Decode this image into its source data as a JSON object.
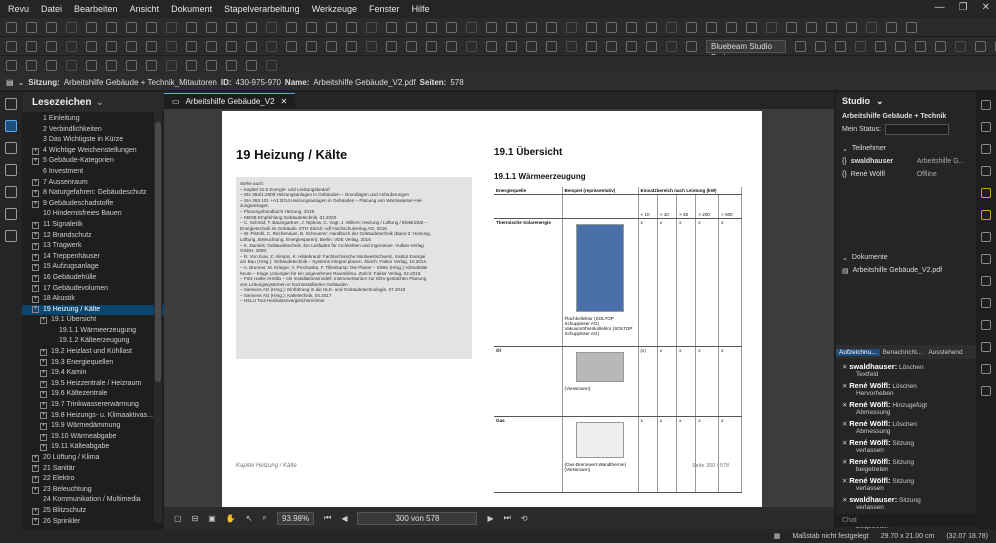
{
  "menu": [
    "Revu",
    "Datei",
    "Bearbeiten",
    "Ansicht",
    "Dokument",
    "Stapelverarbeitung",
    "Werkzeuge",
    "Fenster",
    "Hilfe"
  ],
  "toolbar": {
    "profile": "Bluebeam Studio Proje"
  },
  "infobar": {
    "session_label": "Sitzung:",
    "session_value": "Arbeitshilfe Gebäude + Technik_Mitautoren",
    "id_label": "ID:",
    "id_value": "430-975-970",
    "name_label": "Name:",
    "name_value": "Arbeitshilfe Gebäude_V2.pdf",
    "pages_label": "Seiten:",
    "pages_value": "578"
  },
  "sidebar": {
    "title": "Lesezeichen",
    "items": [
      {
        "label": "1 Einleitung",
        "indent": 0,
        "exp": false
      },
      {
        "label": "2 Verbindlichkeiten",
        "indent": 0,
        "exp": false
      },
      {
        "label": "3 Das Wichtigste in Kürze",
        "indent": 0,
        "exp": false
      },
      {
        "label": "4 Wichtige Weichenstellungen",
        "indent": 0,
        "exp": true
      },
      {
        "label": "5 Gebäude-Kategorien",
        "indent": 0,
        "exp": true
      },
      {
        "label": "6 Investment",
        "indent": 0,
        "exp": false
      },
      {
        "label": "7 Aussenraum",
        "indent": 0,
        "exp": true
      },
      {
        "label": "8 Naturgefahren: Gebäudeschutz",
        "indent": 0,
        "exp": true
      },
      {
        "label": "9 Gebäudeschadstoffe",
        "indent": 0,
        "exp": true
      },
      {
        "label": "10 Hindernisfreies Bauen",
        "indent": 0,
        "exp": false
      },
      {
        "label": "11 Signaletik",
        "indent": 0,
        "exp": true
      },
      {
        "label": "12 Brandschutz",
        "indent": 0,
        "exp": true
      },
      {
        "label": "13 Tragwerk",
        "indent": 0,
        "exp": true
      },
      {
        "label": "14 Treppenhäuser",
        "indent": 0,
        "exp": true
      },
      {
        "label": "15 Aufzugsanlage",
        "indent": 0,
        "exp": true
      },
      {
        "label": "16 Gebäudehülle",
        "indent": 0,
        "exp": true
      },
      {
        "label": "17 Gebäudevolumen",
        "indent": 0,
        "exp": true
      },
      {
        "label": "18 Akustik",
        "indent": 0,
        "exp": true
      },
      {
        "label": "19 Heizung / Kälte",
        "indent": 0,
        "exp": true,
        "selected": true
      },
      {
        "label": "19.1 Übersicht",
        "indent": 1,
        "exp": true
      },
      {
        "label": "19.1.1 Wärmeerzeugung",
        "indent": 2,
        "exp": false
      },
      {
        "label": "19.1.2 Kälteerzeugung",
        "indent": 2,
        "exp": false
      },
      {
        "label": "19.2 Heizlast und Kühllast",
        "indent": 1,
        "exp": true
      },
      {
        "label": "19.3 Energiequellen",
        "indent": 1,
        "exp": true
      },
      {
        "label": "19.4 Kamin",
        "indent": 1,
        "exp": true
      },
      {
        "label": "19.5 Heizzentrale / Heizraum",
        "indent": 1,
        "exp": true
      },
      {
        "label": "19.6 Kältezentrale",
        "indent": 1,
        "exp": true
      },
      {
        "label": "19.7 Trinkwassererwärmung",
        "indent": 1,
        "exp": true
      },
      {
        "label": "19.8 Heizungs- u. Klimaaktivas...",
        "indent": 1,
        "exp": true
      },
      {
        "label": "19.9 Wärmedämmung",
        "indent": 1,
        "exp": true
      },
      {
        "label": "19.10 Wärmeabgabe",
        "indent": 1,
        "exp": true
      },
      {
        "label": "19.11 Kälteabgabe",
        "indent": 1,
        "exp": true
      },
      {
        "label": "20 Lüftung / Klima",
        "indent": 0,
        "exp": true
      },
      {
        "label": "21 Sanitär",
        "indent": 0,
        "exp": true
      },
      {
        "label": "22 Elektro",
        "indent": 0,
        "exp": true
      },
      {
        "label": "23 Beleuchtung",
        "indent": 0,
        "exp": true
      },
      {
        "label": "24 Kommunikation / Multimedia",
        "indent": 0,
        "exp": false
      },
      {
        "label": "25 Blitzschutz",
        "indent": 0,
        "exp": true
      },
      {
        "label": "26 Sprinkler",
        "indent": 0,
        "exp": true
      }
    ]
  },
  "doc_tab": "Arbeitshilfe Gebäude_V2",
  "page": {
    "heading": "19   Heizung / Kälte",
    "refs": [
      "Siehe auch:",
      "– Kapitel 31.9 Energie- und Leistungsbedarf",
      "– SIA 384/1:2009 Heizungsanlagen in Gebäuden – Grundlagen und Anforderungen",
      "– SIA 384.101 +A1:2014 Heizungsanlagen in Gebäuden – Planung von Warmwasser-Hei-",
      "  zungsanlagen",
      "– Planungshandbuch Heizung, 2019",
      "– KBOB Empfehlung Gebäudetechnik, 01.2020",
      "– C. Schmid, T. Baumgartner, J. Nipkow, C. Vogt, J. Willers: Heizung / Lüftung / Elektrizität –",
      "  Energietechnik im Gebäude. ETH Zürich: vdf Hochschulverlag AG, 2016.",
      "– W. Pistohl, C. Rechenauer, B. Scheuerer: Handbuch der Gebäudetechnik (Band 2: Heizung,",
      "  Lüftung, Beleuchtung, Energiesparen). Berlin: VDE Verlag, 2016.",
      "– K. Daniels: Gebäudetechnik. Ein Leitfaden für Architekten und Ingenieure. Vulkan-Verlag",
      "  GmbH, 2000.",
      "– R. Von Euw, Z. Alimpic, K. Hildebrand: Fachtechnische Nordwestschweiz, Institut Energie",
      "  am Bau (Hrsg.): Gebäudetechnik – Systeme integral planen. Zürich: Faktor Verlag, 10.2012.",
      "– A. Brunner, M. Krieger, V. Prochaska, F. Tillenkamp: Die Planer – SWKI (Hrsg.): Klimakälte",
      "  heute – Kluge Lösungen für ein angenehmes Raumklima. Zürich: Faktor Verlag, 02.2019.",
      "– Fritz Haller Armilla – ein Installationsmodell: Instrumentarium zur EDV-gestützten Planung",
      "  von Leitungssystemen in hochinstallierten Gebäuden",
      "– Siemens AG (Hrsg.): Einführung in die HLK- und Gebäudetechnologie, 07.2019",
      "– Siemens AG (Hrsg.): Kältetechnik, 04.2017",
      "– HSLU Tool Heizlastenvergleichsrechner"
    ],
    "section": "19.1   Übersicht",
    "subsection": "19.1.1   Wärmeerzeugung",
    "table": {
      "h_source": "Energiequelle",
      "h_example": "Beispiel (repräsentativ)",
      "h_range": "Einsatzbereich nach Leistung (kW)",
      "ranges": [
        "< 10",
        "> 10",
        "> 30",
        "> 200",
        "> 500"
      ],
      "rows": [
        {
          "name": "Thermische Solarenergie",
          "ex1": "Flachkollektor (SOLTOP Schuppisser AG)",
          "ex2": "Vakuumröhrenkollektor (SOLTOP Schuppisser AG)",
          "marks": [
            "x",
            "x",
            "x",
            "x",
            "x"
          ]
        },
        {
          "name": "Öl",
          "ex1": "(Viessmann)",
          "ex2": "",
          "marks": [
            "(x)",
            "x",
            "x",
            "x",
            "x"
          ]
        },
        {
          "name": "Gas",
          "ex1": "(Gas-Brennwert-Wandtherme)",
          "ex2": "(Viessmann)",
          "marks": [
            "x",
            "x",
            "x",
            "x",
            "x"
          ]
        }
      ]
    },
    "footer_left": "Kapitel Heizung / Kälte",
    "footer_right": "Seite 300 / 578"
  },
  "statusbar": {
    "zoom": "93.98%",
    "page_of": "300 von 578"
  },
  "bottombar": {
    "scale": "Maßstab nicht festgelegt",
    "size": "29.70 x 21.00 cm",
    "coords": "(32.07 18.78)"
  },
  "studio": {
    "title": "Studio",
    "session": "Arbeitshilfe Gebäude + Technik",
    "status_label": "Mein Status:",
    "participants_label": "Teilnehmer",
    "participants": [
      {
        "name": "swaldhauser",
        "doc": "Arbeitshilfe G..."
      },
      {
        "name": "René Wölfl",
        "doc": "Offline"
      }
    ],
    "documents_label": "Dokumente",
    "document": "Arbeitshilfe Gebäude_V2.pdf",
    "tabs": [
      "Aufzeichnu...",
      "Benachricht...",
      "Ausstehend"
    ],
    "records": [
      {
        "user": "swaldhauser:",
        "action": "Löschen",
        "detail": "Textfeld"
      },
      {
        "user": "René Wölfl:",
        "action": "Löschen",
        "detail": "Hervorheben"
      },
      {
        "user": "René Wölfl:",
        "action": "Hinzugefügt",
        "detail": "Abmessung"
      },
      {
        "user": "René Wölfl:",
        "action": "Löschen",
        "detail": "Abmessung"
      },
      {
        "user": "René Wölfl:",
        "action": "Sitzung",
        "detail": "verlassen"
      },
      {
        "user": "René Wölfl:",
        "action": "Sitzung",
        "detail": "beigetreten"
      },
      {
        "user": "René Wölfl:",
        "action": "Sitzung",
        "detail": "verlassen"
      },
      {
        "user": "swaldhauser:",
        "action": "Sitzung",
        "detail": "verlassen"
      },
      {
        "user": "swaldhauser:",
        "action": "Sitzung",
        "detail": "beigetreten"
      }
    ],
    "chat_placeholder": "Chat"
  }
}
